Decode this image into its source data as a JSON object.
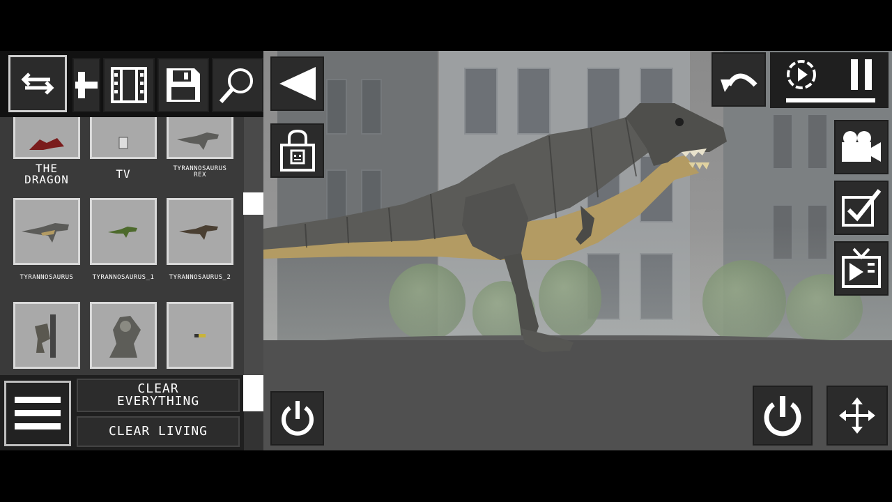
{
  "catalog": {
    "items": [
      {
        "label": "THE\nDRAGON",
        "size": "big"
      },
      {
        "label": "TV",
        "size": "big"
      },
      {
        "label": "TYRANNOSAURUS\nREX",
        "size": "small"
      },
      {
        "label": "TYRANNOSAURUS",
        "size": "small"
      },
      {
        "label": "TYRANNOSAURUS_1",
        "size": "small"
      },
      {
        "label": "TYRANNOSAURUS_2",
        "size": "small"
      },
      {
        "label": "",
        "size": "small"
      },
      {
        "label": "",
        "size": "small"
      },
      {
        "label": "",
        "size": "small"
      }
    ]
  },
  "actions": {
    "clear_everything": "CLEAR\nEVERYTHING",
    "clear_living": "CLEAR LIVING"
  },
  "colors": {
    "panel": "#333333",
    "button": "#2b2b2b",
    "thumb": "#a9a9a9",
    "dino_body": "#5b5b58",
    "dino_belly": "#b39b63"
  },
  "icons": {
    "toolbar": [
      "swap-arrows-icon",
      "add-icon",
      "film-strip-icon",
      "floppy-disk-icon",
      "magnifier-icon"
    ],
    "scene_left": [
      "collapse-triangle-icon",
      "locked-lock-icon",
      "power-icon"
    ],
    "scene_right": [
      "undo-icon",
      "slow-motion-icon",
      "pause-icon",
      "camera-icon",
      "checkbox-icon",
      "tv-icon",
      "power-icon",
      "move-arrows-icon"
    ]
  }
}
